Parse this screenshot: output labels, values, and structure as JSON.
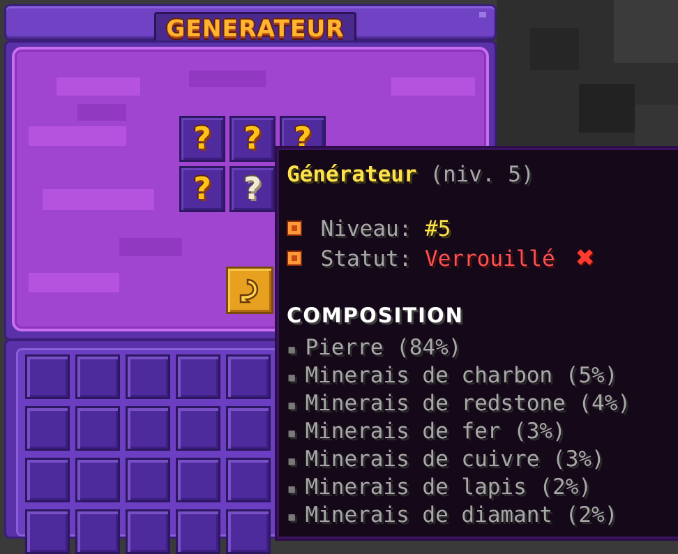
{
  "window": {
    "title": "GENERATEUR"
  },
  "generator_slots": [
    {
      "icon": "question-mark-icon",
      "glyph": "?",
      "variant": "gold"
    },
    {
      "icon": "question-mark-icon",
      "glyph": "?",
      "variant": "gold"
    },
    {
      "icon": "question-mark-icon",
      "glyph": "?",
      "variant": "gold"
    },
    {
      "icon": "question-mark-icon",
      "glyph": "?",
      "variant": "gold"
    },
    {
      "icon": "question-mark-icon",
      "glyph": "?",
      "variant": "pale"
    }
  ],
  "back_button": {
    "icon": "back-arrow-icon"
  },
  "tooltip": {
    "title": "Générateur",
    "level_suffix": "(niv. 5)",
    "attributes": [
      {
        "label": "Niveau:",
        "value": "#5",
        "value_color": "#ffe14b"
      },
      {
        "label": "Statut:",
        "value": "Verrouillé",
        "value_color": "#ff5050",
        "icon": "x-icon"
      }
    ],
    "composition_heading": "COMPOSITION",
    "composition": [
      "Pierre (84%)",
      "Minerais de charbon (5%)",
      "Minerais de redstone (4%)",
      "Minerais de fer (3%)",
      "Minerais de cuivre (3%)",
      "Minerais de lapis (2%)",
      "Minerais de diamant (2%)"
    ]
  },
  "colors": {
    "panel_purple": "#a045d0",
    "title_gold": "#ffb52e",
    "tooltip_bg": "#150818",
    "accent_yellow": "#ffe14b",
    "locked_red": "#ff5050"
  }
}
